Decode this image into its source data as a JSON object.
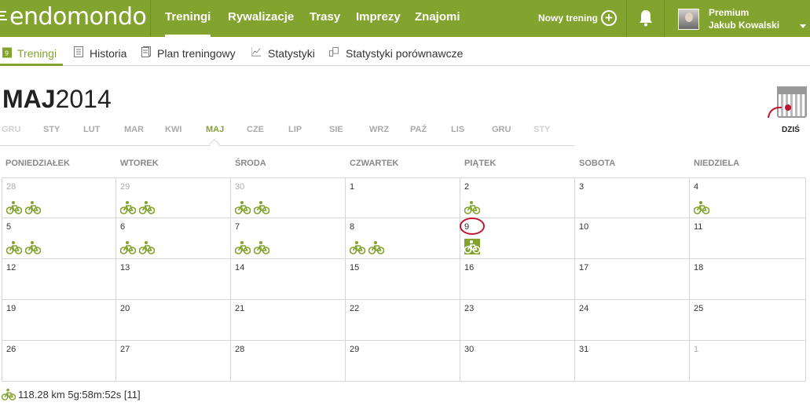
{
  "brand": {
    "logo_text": "endomondo"
  },
  "topnav": {
    "items": [
      "Treningi",
      "Rywalizacje",
      "Trasy",
      "Imprezy",
      "Znajomi"
    ],
    "new_training": "Nowy trening",
    "user": {
      "status": "Premium",
      "name": "Jakub Kowalski"
    }
  },
  "subnav": [
    "Treningi",
    "Historia",
    "Plan treningowy",
    "Statystyki",
    "Statystyki porównawcze"
  ],
  "calendar": {
    "month": "MAJ",
    "year": "2014",
    "months": [
      "GRU",
      "STY",
      "LUT",
      "MAR",
      "KWI",
      "MAJ",
      "CZE",
      "LIP",
      "SIE",
      "WRZ",
      "PAŹ",
      "LIS",
      "GRU",
      "STY"
    ],
    "active_month": "MAJ",
    "today_label": "DZIŚ",
    "weekdays": [
      "PONIEDZIAŁEK",
      "WTOREK",
      "ŚRODA",
      "CZWARTEK",
      "PIĄTEK",
      "SOBOTA",
      "NIEDZIELA"
    ],
    "weeks": [
      [
        {
          "day": "28",
          "other": true,
          "workouts": 2
        },
        {
          "day": "29",
          "other": true,
          "workouts": 2
        },
        {
          "day": "30",
          "other": true,
          "workouts": 2
        },
        {
          "day": "1",
          "workouts": 0
        },
        {
          "day": "2",
          "workouts": 1
        },
        {
          "day": "3",
          "workouts": 0
        },
        {
          "day": "4",
          "workouts": 1
        }
      ],
      [
        {
          "day": "5",
          "workouts": 2
        },
        {
          "day": "6",
          "workouts": 2
        },
        {
          "day": "7",
          "workouts": 2
        },
        {
          "day": "8",
          "workouts": 2
        },
        {
          "day": "9",
          "workouts": 1,
          "today": true,
          "highlighted": true
        },
        {
          "day": "10",
          "workouts": 0
        },
        {
          "day": "11",
          "workouts": 0
        }
      ],
      [
        {
          "day": "12"
        },
        {
          "day": "13"
        },
        {
          "day": "14"
        },
        {
          "day": "15"
        },
        {
          "day": "16"
        },
        {
          "day": "17"
        },
        {
          "day": "18"
        }
      ],
      [
        {
          "day": "19"
        },
        {
          "day": "20"
        },
        {
          "day": "21"
        },
        {
          "day": "22"
        },
        {
          "day": "23"
        },
        {
          "day": "24"
        },
        {
          "day": "25"
        }
      ],
      [
        {
          "day": "26"
        },
        {
          "day": "27"
        },
        {
          "day": "28"
        },
        {
          "day": "29"
        },
        {
          "day": "30"
        },
        {
          "day": "31"
        },
        {
          "day": "1",
          "other": true
        }
      ]
    ],
    "today_circle_color": "#c0152f"
  },
  "summary": {
    "text": "118.28 km 5g:58m:52s [11]",
    "icon": "bicycle-icon"
  },
  "colors": {
    "brand_green": "#82a32e",
    "grid_line": "#d6d6d6"
  }
}
